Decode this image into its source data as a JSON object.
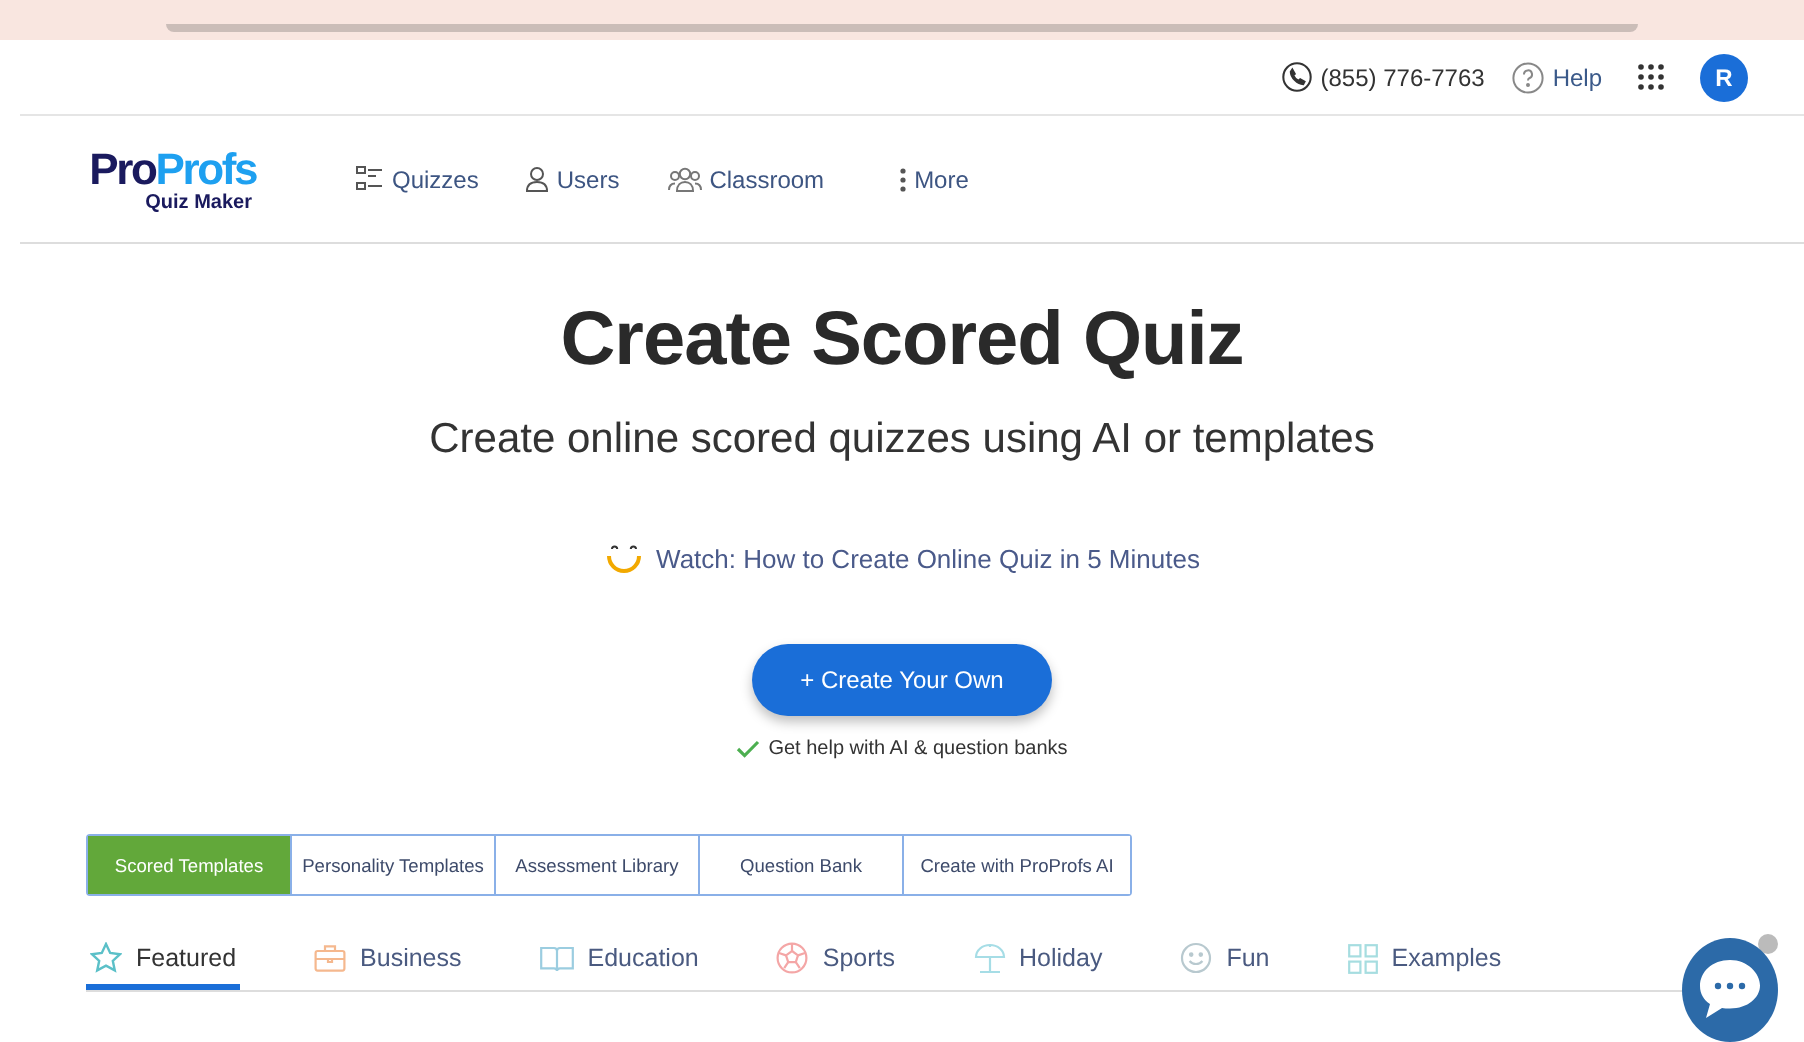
{
  "top_bar": {
    "phone": "(855) 776-7763",
    "help": "Help",
    "avatar": "R"
  },
  "logo": {
    "brand_first": "Pro",
    "brand_second": "Profs",
    "product": "Quiz Maker"
  },
  "nav": [
    {
      "label": "Quizzes",
      "kind": "list"
    },
    {
      "label": "Users",
      "kind": "user"
    },
    {
      "label": "Classroom",
      "kind": "group"
    },
    {
      "label": "More",
      "kind": "more"
    }
  ],
  "hero": {
    "title": "Create Scored Quiz",
    "subtitle": "Create online scored quizzes using AI or templates",
    "watch_link": "Watch: How to Create Online Quiz in 5 Minutes",
    "create_button": "+ Create Your Own",
    "help_note": "Get help with AI & question banks"
  },
  "template_tabs": [
    {
      "label": "Scored Templates",
      "selected": true
    },
    {
      "label": "Personality Templates",
      "selected": false
    },
    {
      "label": "Assessment Library",
      "selected": false
    },
    {
      "label": "Question Bank",
      "selected": false
    },
    {
      "label": "Create with ProProfs AI",
      "selected": false
    }
  ],
  "categories": [
    {
      "label": "Featured",
      "kind": "star",
      "selected": true
    },
    {
      "label": "Business",
      "kind": "briefcase",
      "selected": false
    },
    {
      "label": "Education",
      "kind": "book",
      "selected": false
    },
    {
      "label": "Sports",
      "kind": "ball",
      "selected": false
    },
    {
      "label": "Holiday",
      "kind": "umbrella",
      "selected": false
    },
    {
      "label": "Fun",
      "kind": "smiley",
      "selected": false
    },
    {
      "label": "Examples",
      "kind": "grid",
      "selected": false
    }
  ]
}
